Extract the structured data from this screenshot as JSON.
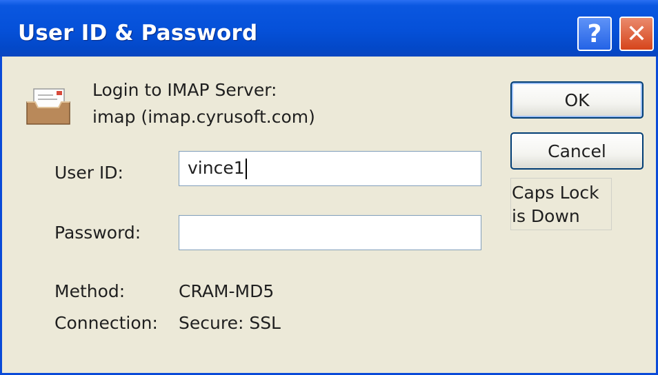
{
  "window": {
    "title": "User ID & Password",
    "help_glyph": "?",
    "close_glyph": "✕"
  },
  "server": {
    "icon": "mail-tray-icon",
    "prompt": "Login to IMAP Server:",
    "name": "imap (imap.cyrusoft.com)"
  },
  "form": {
    "user_id_label": "User ID:",
    "user_id_value": "vince1",
    "password_label": "Password:",
    "password_value": ""
  },
  "info": {
    "method_label": "Method:",
    "method_value": "CRAM-MD5",
    "connection_label": "Connection:",
    "connection_value": "Secure: SSL"
  },
  "buttons": {
    "ok_label": "OK",
    "cancel_label": "Cancel"
  },
  "status": {
    "caps_line1": "Caps Lock",
    "caps_line2": "is Down"
  },
  "colors": {
    "titlebar": "#0550d8",
    "dialog_bg": "#ece9d8",
    "close_button": "#d6451c"
  }
}
